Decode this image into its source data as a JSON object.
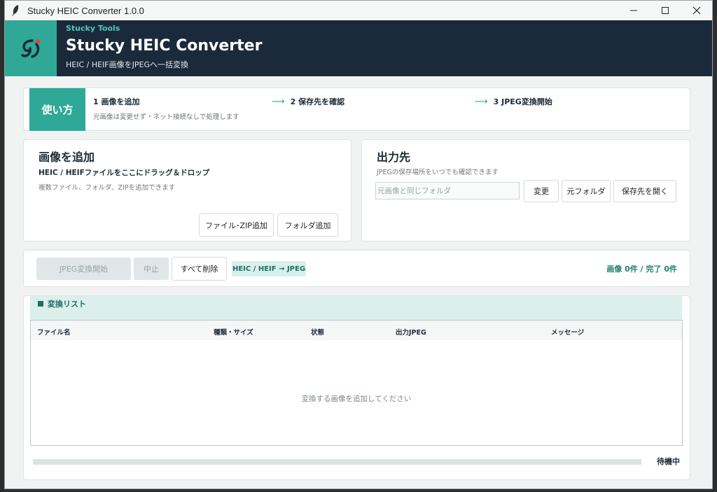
{
  "window": {
    "title": "Stucky HEIC Converter 1.0.0"
  },
  "header": {
    "brand": "Stucky Tools",
    "title": "Stucky HEIC Converter",
    "subtitle": "HEIC / HEIF画像をJPEGへ一括変換"
  },
  "howto": {
    "badge": "使い方",
    "steps": [
      "1  画像を追加",
      "2  保存先を確認",
      "3  JPEG変換開始"
    ],
    "arrow": "⟶",
    "note": "元画像は変更せず・ネット接続なしで処理します"
  },
  "add_images": {
    "title": "画像を追加",
    "drop_text": "HEIC / HEIFファイルをここにドラッグ＆ドロップ",
    "note": "複数ファイル、フォルダ、ZIPを追加できます",
    "add_file_zip_label": "ファイル･ZIP追加",
    "add_folder_label": "フォルダ追加"
  },
  "output": {
    "title": "出力先",
    "note": "JPEGの保存場所をいつでも確認できます",
    "folder_placeholder": "元画像と同じフォルダ",
    "change_label": "変更",
    "source_folder_label": "元フォルダ",
    "open_dest_label": "保存先を開く"
  },
  "actions": {
    "start_label": "JPEG変換開始",
    "stop_label": "中止",
    "clear_label": "すべて削除",
    "format_tag": "HEIC / HEIF → JPEG",
    "counts": "画像 0件 / 完了 0件"
  },
  "list": {
    "title": "変換リスト",
    "columns": [
      "ファイル名",
      "種類・サイズ",
      "状態",
      "出力JPEG",
      "メッセージ"
    ],
    "empty_message": "変換する画像を追加してください"
  },
  "progress": {
    "value_percent": 0,
    "status": "待機中"
  },
  "colors": {
    "accent": "#2fa898",
    "header_bg": "#1b2a3a",
    "accent_dark": "#1e6d63"
  }
}
